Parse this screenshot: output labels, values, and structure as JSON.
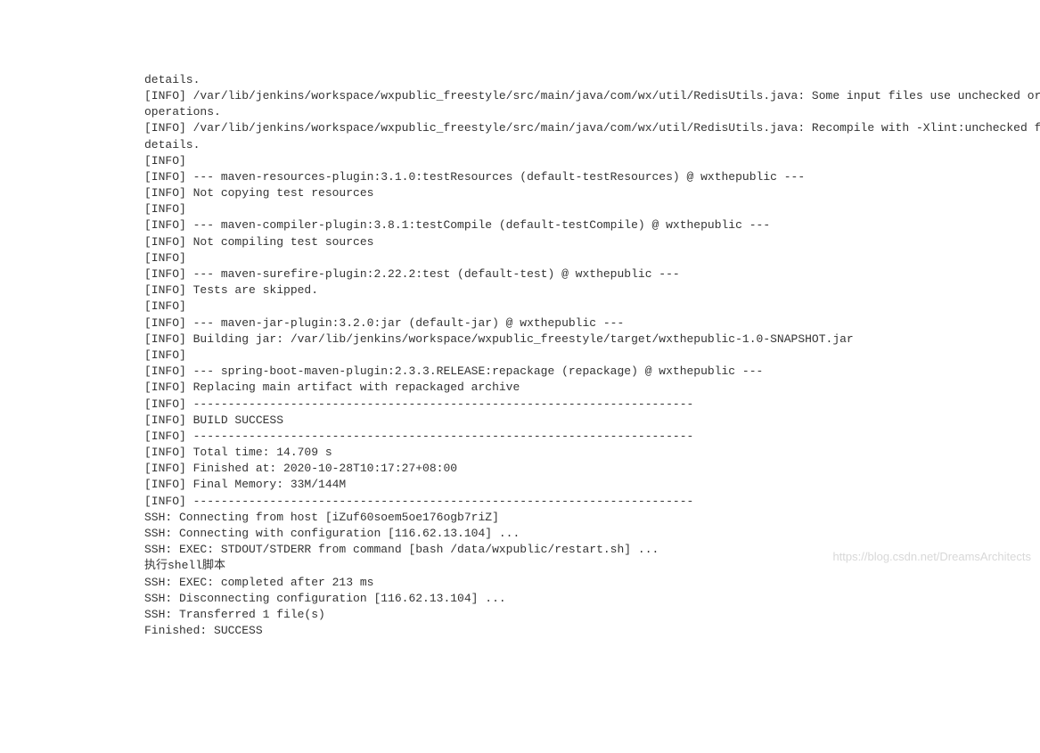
{
  "console": {
    "lines": [
      "details.",
      "[INFO] /var/lib/jenkins/workspace/wxpublic_freestyle/src/main/java/com/wx/util/RedisUtils.java: Some input files use unchecked or uns",
      "operations.",
      "[INFO] /var/lib/jenkins/workspace/wxpublic_freestyle/src/main/java/com/wx/util/RedisUtils.java: Recompile with -Xlint:unchecked for ",
      "details.",
      "[INFO] ",
      "[INFO] --- maven-resources-plugin:3.1.0:testResources (default-testResources) @ wxthepublic ---",
      "[INFO] Not copying test resources",
      "[INFO] ",
      "[INFO] --- maven-compiler-plugin:3.8.1:testCompile (default-testCompile) @ wxthepublic ---",
      "[INFO] Not compiling test sources",
      "[INFO] ",
      "[INFO] --- maven-surefire-plugin:2.22.2:test (default-test) @ wxthepublic ---",
      "[INFO] Tests are skipped.",
      "[INFO] ",
      "[INFO] --- maven-jar-plugin:3.2.0:jar (default-jar) @ wxthepublic ---",
      "[INFO] Building jar: /var/lib/jenkins/workspace/wxpublic_freestyle/target/wxthepublic-1.0-SNAPSHOT.jar",
      "[INFO] ",
      "[INFO] --- spring-boot-maven-plugin:2.3.3.RELEASE:repackage (repackage) @ wxthepublic ---",
      "[INFO] Replacing main artifact with repackaged archive",
      "[INFO] ------------------------------------------------------------------------",
      "[INFO] BUILD SUCCESS",
      "[INFO] ------------------------------------------------------------------------",
      "[INFO] Total time: 14.709 s",
      "[INFO] Finished at: 2020-10-28T10:17:27+08:00",
      "[INFO] Final Memory: 33M/144M",
      "[INFO] ------------------------------------------------------------------------",
      "SSH: Connecting from host [iZuf60soem5oe176ogb7riZ]",
      "SSH: Connecting with configuration [116.62.13.104] ...",
      "SSH: EXEC: STDOUT/STDERR from command [bash /data/wxpublic/restart.sh] ...",
      "执行shell脚本",
      "SSH: EXEC: completed after 213 ms",
      "SSH: Disconnecting configuration [116.62.13.104] ...",
      "SSH: Transferred 1 file(s)",
      "Finished: SUCCESS"
    ]
  },
  "watermark": "https://blog.csdn.net/DreamsArchitects"
}
